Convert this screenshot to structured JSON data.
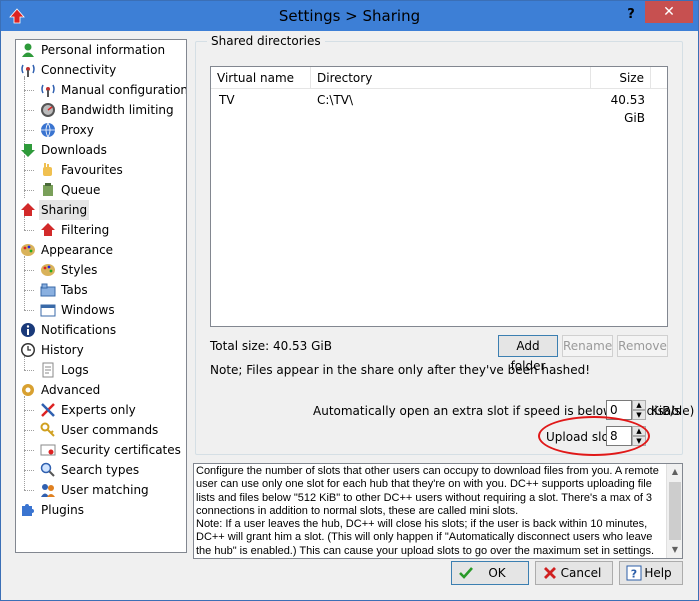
{
  "window": {
    "title": "Settings > Sharing",
    "help_glyph": "?",
    "close_glyph": "✕"
  },
  "tree": [
    {
      "label": "Personal information",
      "icon": "person-icon"
    },
    {
      "label": "Connectivity",
      "icon": "antenna-icon"
    },
    {
      "label": "Manual configuration",
      "icon": "antenna-icon"
    },
    {
      "label": "Bandwidth limiting",
      "icon": "gauge-icon"
    },
    {
      "label": "Proxy",
      "icon": "globe-icon"
    },
    {
      "label": "Downloads",
      "icon": "download-arrow-icon"
    },
    {
      "label": "Favourites",
      "icon": "hand-icon"
    },
    {
      "label": "Queue",
      "icon": "queue-icon"
    },
    {
      "label": "Sharing",
      "icon": "upload-arrow-icon",
      "selected": true
    },
    {
      "label": "Filtering",
      "icon": "upload-arrow-icon"
    },
    {
      "label": "Appearance",
      "icon": "palette-icon"
    },
    {
      "label": "Styles",
      "icon": "palette-icon"
    },
    {
      "label": "Tabs",
      "icon": "tabs-icon"
    },
    {
      "label": "Windows",
      "icon": "windows-icon"
    },
    {
      "label": "Notifications",
      "icon": "info-icon"
    },
    {
      "label": "History",
      "icon": "clock-icon"
    },
    {
      "label": "Logs",
      "icon": "log-icon"
    },
    {
      "label": "Advanced",
      "icon": "gear-icon"
    },
    {
      "label": "Experts only",
      "icon": "tools-icon"
    },
    {
      "label": "User commands",
      "icon": "key-icon"
    },
    {
      "label": "Security certificates",
      "icon": "certificate-icon"
    },
    {
      "label": "Search types",
      "icon": "magnifier-icon"
    },
    {
      "label": "User matching",
      "icon": "users-icon"
    },
    {
      "label": "Plugins",
      "icon": "puzzle-icon"
    }
  ],
  "shared": {
    "group_label": "Shared directories",
    "columns": {
      "virtual_name": "Virtual name",
      "directory": "Directory",
      "size": "Size"
    },
    "rows": [
      {
        "virtual_name": "TV",
        "directory": "C:\\TV\\",
        "size": "40.53 GiB"
      }
    ],
    "total_size": "Total size: 40.53 GiB",
    "add_folder": "Add folder",
    "rename": "Rename",
    "remove": "Remove",
    "note": "Note; Files appear in the share only after they've been hashed!",
    "extra_slot_label": "Automatically open an extra slot if speed is below (0 = disable)",
    "extra_slot_value": "0",
    "extra_slot_unit": "KiB/s",
    "upload_slots_label": "Upload slots",
    "upload_slots_value": "8"
  },
  "description": "Configure the number of slots that other users can occupy to download files from you. A remote user can use only one slot for each hub that they're on with you. DC++ supports uploading file lists and files below \"512 KiB\" to other DC++ users without requiring a slot. There's a max of 3 connections in addition to normal slots, these are called mini slots.\nNote: If a user leaves the hub, DC++ will close his slots; if the user is back within 10 minutes, DC++ will grant him a slot. (This will only happen if \"Automatically disconnect users who leave the hub\" is enabled.) This can cause your upload slots to go over the maximum set in settings.",
  "buttons": {
    "ok": "OK",
    "cancel": "Cancel",
    "help": "Help"
  },
  "colors": {
    "titlebar": "#3d7fd6",
    "close": "#c75050",
    "annotation": "#e01818"
  }
}
